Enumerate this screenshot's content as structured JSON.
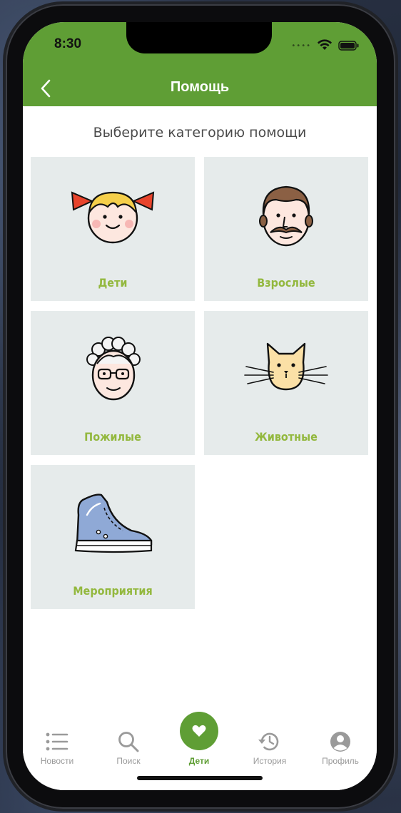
{
  "status_bar": {
    "time": "8:30",
    "signal_dots": "•••• "
  },
  "header": {
    "title": "Помощь"
  },
  "subtitle": "Выберите категорию помощи",
  "categories": [
    {
      "label": "Дети",
      "icon": "girl-face-icon"
    },
    {
      "label": "Взрослые",
      "icon": "man-face-icon"
    },
    {
      "label": "Пожилые",
      "icon": "grandma-face-icon"
    },
    {
      "label": "Животные",
      "icon": "cat-face-icon"
    },
    {
      "label": "Мероприятия",
      "icon": "sneaker-icon"
    }
  ],
  "tabbar": {
    "items": [
      {
        "label": "Новости",
        "icon": "list-icon"
      },
      {
        "label": "Поиск",
        "icon": "search-icon"
      },
      {
        "label": "Дети",
        "icon": "heart-icon",
        "active": true
      },
      {
        "label": "История",
        "icon": "history-icon"
      },
      {
        "label": "Профиль",
        "icon": "profile-icon"
      }
    ]
  },
  "colors": {
    "accent": "#5f9e35",
    "label": "#93b83e",
    "card": "#e6ebeb"
  }
}
